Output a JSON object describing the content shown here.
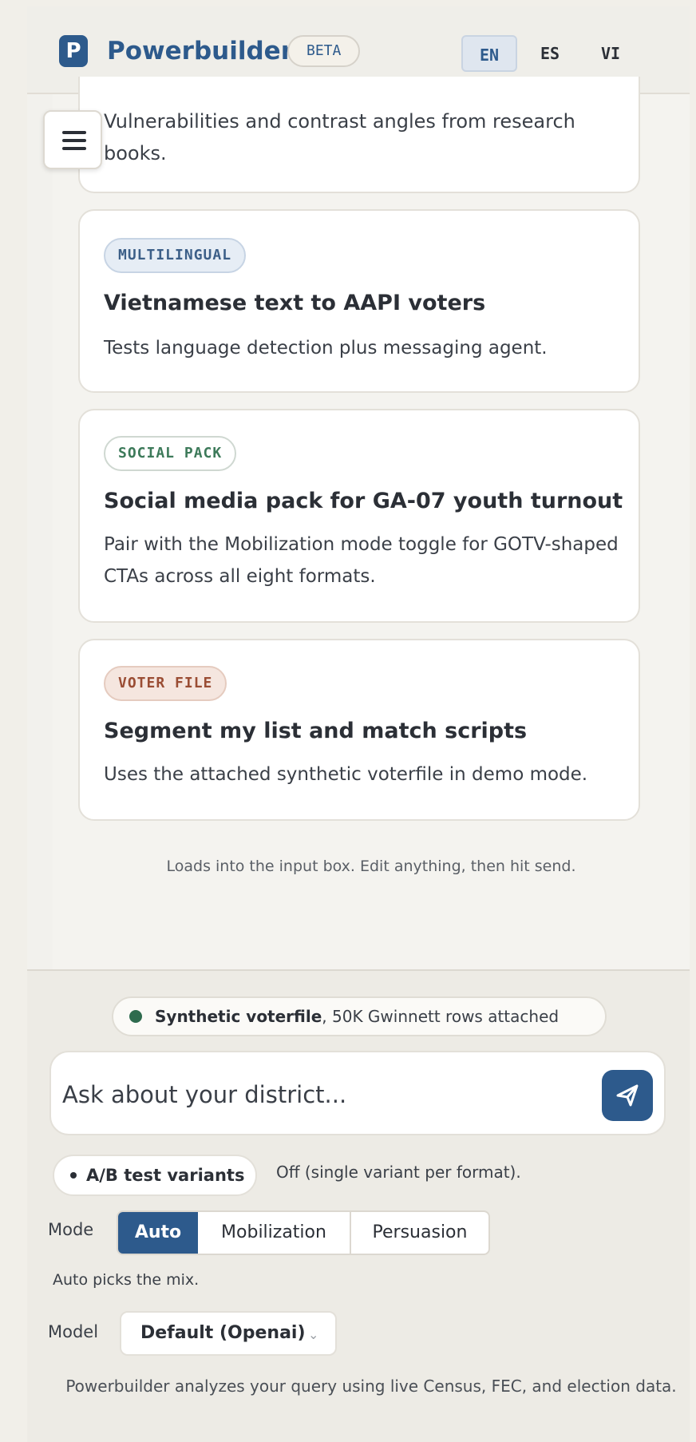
{
  "header": {
    "logo_letter": "P",
    "brand": "Powerbuilder",
    "beta_badge": "BETA",
    "languages": [
      "EN",
      "ES",
      "VI"
    ],
    "active_language": "EN"
  },
  "cards": [
    {
      "tag": "",
      "title": "",
      "description": "Vulnerabilities and contrast angles from research books."
    },
    {
      "tag": "MULTILINGUAL",
      "title": "Vietnamese text to AAPI voters",
      "description": "Tests language detection plus messaging agent."
    },
    {
      "tag": "SOCIAL PACK",
      "title": "Social media pack for GA-07 youth turnout",
      "description": "Pair with the Mobilization mode toggle for GOTV-shaped CTAs across all eight formats."
    },
    {
      "tag": "VOTER FILE",
      "title": "Segment my list and match scripts",
      "description": "Uses the attached synthetic voterfile in demo mode."
    }
  ],
  "hint": "Loads into the input box. Edit anything, then hit send.",
  "attachment": {
    "label_strong": "Synthetic voterfile",
    "label_rest": ", 50K Gwinnett rows attached"
  },
  "composer": {
    "placeholder": "Ask about your district..."
  },
  "ab_test": {
    "label": "A/B test variants",
    "status": "Off (single variant per format)."
  },
  "mode": {
    "label": "Mode",
    "options": [
      "Auto",
      "Mobilization",
      "Persuasion"
    ],
    "selected": "Auto",
    "note": "Auto picks the mix."
  },
  "model": {
    "label": "Model",
    "selected": "Default (Openai)"
  },
  "footer": "Powerbuilder analyzes your query using live Census, FEC, and election data.",
  "colors": {
    "brand": "#2d5a8c",
    "background": "#f2f1ed",
    "attach_dot": "#2e6b4e"
  }
}
